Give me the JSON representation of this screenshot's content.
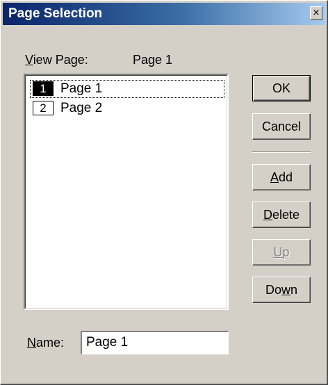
{
  "window": {
    "title": "Page Selection",
    "close_glyph": "×",
    "title_gradient": [
      "#0a246a",
      "#a6caf0"
    ],
    "face_color": "#d4d0c8"
  },
  "view_page": {
    "label_underline": "V",
    "label_rest": "iew Page:",
    "value": "Page 1"
  },
  "pages": [
    {
      "number": "1",
      "name": "Page 1",
      "selected": true
    },
    {
      "number": "2",
      "name": "Page 2",
      "selected": false
    }
  ],
  "buttons": {
    "ok": {
      "label": "OK",
      "default": true,
      "enabled": true
    },
    "cancel": {
      "label": "Cancel",
      "enabled": true
    },
    "add": {
      "underline": "A",
      "rest": "dd",
      "enabled": true
    },
    "delete": {
      "underline": "D",
      "rest": "elete",
      "enabled": true
    },
    "up": {
      "underline": "U",
      "rest": "p",
      "enabled": false
    },
    "down": {
      "pre": "Do",
      "underline": "w",
      "rest": "n",
      "enabled": true
    }
  },
  "name_field": {
    "label_underline": "N",
    "label_rest": "ame:",
    "value": "Page 1"
  },
  "icons": {
    "close": "close-icon"
  }
}
